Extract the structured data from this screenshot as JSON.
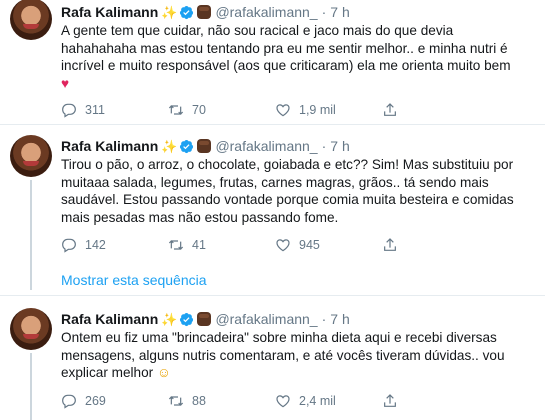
{
  "tweets": [
    {
      "name": "Rafa Kalimann",
      "sparkle": "✨",
      "handle": "@rafakalimann_",
      "dot": "·",
      "time": "7 h",
      "text": "A gente tem que cuidar, não sou racical e jaco mais do que devia\nhahahahaha mas estou tentando pra eu me sentir melhor.. e minha nutri é\nincrível e muito responsável (aos que criticaram) ela me orienta muito bem",
      "trailing_emoji": "♥",
      "replies": "311",
      "retweets": "70",
      "likes": "1,9 mil"
    },
    {
      "name": "Rafa Kalimann",
      "sparkle": "✨",
      "handle": "@rafakalimann_",
      "dot": "·",
      "time": "7 h",
      "text": "Tirou o pão, o arroz, o chocolate, goiabada e etc?? Sim! Mas substituiu por\nmuitaaa salada, legumes, frutas, carnes magras, grãos.. tá sendo mais\nsaudável. Estou passando vontade porque comia muita besteira e comidas\nmais pesadas mas não estou passando fome.",
      "replies": "142",
      "retweets": "41",
      "likes": "945",
      "show_thread": "Mostrar esta sequência"
    },
    {
      "name": "Rafa Kalimann",
      "sparkle": "✨",
      "handle": "@rafakalimann_",
      "dot": "·",
      "time": "7 h",
      "text": "Ontem eu fiz uma \"brincadeira\" sobre minha dieta aqui e recebi diversas\nmensagens, alguns nutris comentaram, e até vocês tiveram dúvidas.. vou\nexplicar melhor",
      "trailing_emoji": "☺",
      "replies": "269",
      "retweets": "88",
      "likes": "2,4 mil"
    }
  ],
  "colors": {
    "text": "#14171a",
    "muted": "#657786",
    "link": "#1da1f2",
    "divider": "#e6ecf0",
    "verified": "#1da1f2",
    "heart": "#e0245e"
  }
}
